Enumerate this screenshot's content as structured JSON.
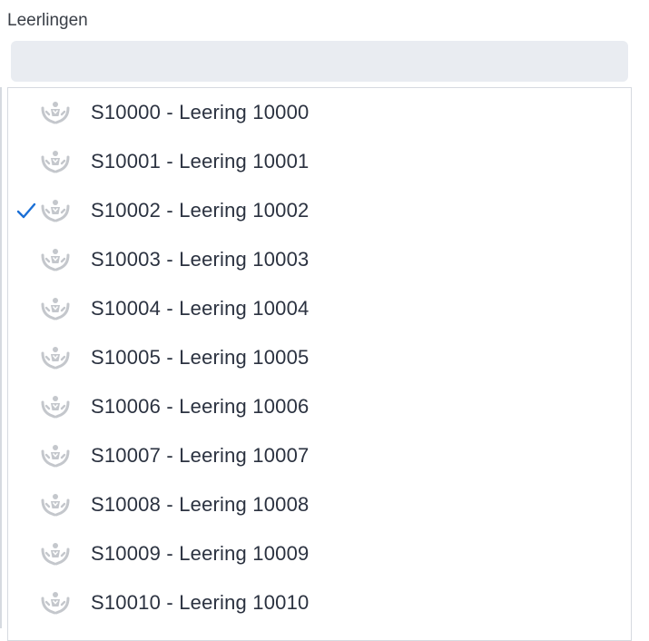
{
  "field": {
    "label": "Leerlingen",
    "search_value": "",
    "search_placeholder": ""
  },
  "colors": {
    "check": "#1a6fd6",
    "icon": "#c4c7cc",
    "text": "#2b3240",
    "search_bg": "#e9ecf1"
  },
  "options": [
    {
      "label": "S10000 - Leering 10000",
      "selected": false,
      "icon": "student-hands-icon"
    },
    {
      "label": "S10001 - Leering 10001",
      "selected": false,
      "icon": "student-hands-icon"
    },
    {
      "label": "S10002 - Leering 10002",
      "selected": true,
      "icon": "student-hands-icon"
    },
    {
      "label": "S10003 - Leering 10003",
      "selected": false,
      "icon": "student-hands-icon"
    },
    {
      "label": "S10004 - Leering 10004",
      "selected": false,
      "icon": "student-hands-icon"
    },
    {
      "label": "S10005 - Leering 10005",
      "selected": false,
      "icon": "student-hands-icon"
    },
    {
      "label": "S10006 - Leering 10006",
      "selected": false,
      "icon": "student-hands-icon"
    },
    {
      "label": "S10007 - Leering 10007",
      "selected": false,
      "icon": "student-hands-icon"
    },
    {
      "label": "S10008 - Leering 10008",
      "selected": false,
      "icon": "student-hands-icon"
    },
    {
      "label": "S10009 - Leering 10009",
      "selected": false,
      "icon": "student-hands-icon"
    },
    {
      "label": "S10010 - Leering 10010",
      "selected": false,
      "icon": "student-hands-icon"
    }
  ]
}
